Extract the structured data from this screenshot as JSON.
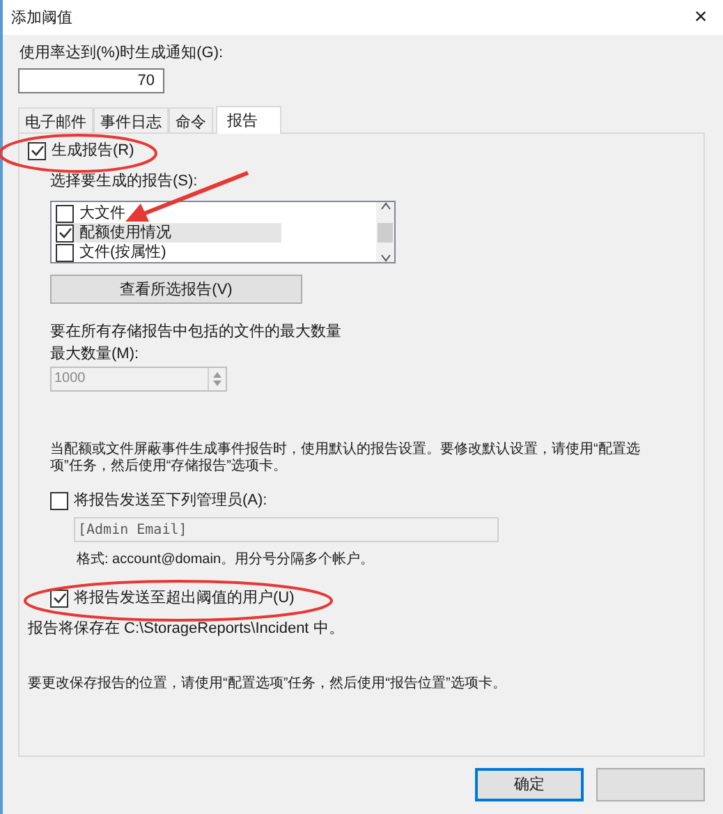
{
  "window": {
    "title": "添加阈值",
    "close": "×"
  },
  "threshold": {
    "label": "使用率达到(%)时生成通知(G):",
    "value": "70"
  },
  "tabs": [
    {
      "label": "电子邮件",
      "selected": false
    },
    {
      "label": "事件日志",
      "selected": false
    },
    {
      "label": "命令",
      "selected": false
    },
    {
      "label": "报告",
      "selected": true
    }
  ],
  "generate_reports": {
    "label": "生成报告(R)",
    "checked": true
  },
  "reports_label": "选择要生成的报告(S):",
  "reports": [
    {
      "label": "大文件",
      "checked": false,
      "selected": false
    },
    {
      "label": "配额使用情况",
      "checked": true,
      "selected": true
    },
    {
      "label": "文件(按属性)",
      "checked": false,
      "selected": false
    }
  ],
  "view_button": "查看所选报告(V)",
  "max_files_text": "要在所有存储报告中包括的文件的最大数量",
  "max_count": {
    "label": "最大数量(M):",
    "value": "1000",
    "disabled": true
  },
  "note": "当配额或文件屏蔽事件生成事件报告时，使用默认的报告设置。要修改默认设置，请使用“配置选项”任务，然后使用“存储报告”选项卡。",
  "send_admins": {
    "label": "将报告发送至下列管理员(A):",
    "checked": false
  },
  "admin_email": {
    "value": "[Admin Email]",
    "disabled": true
  },
  "format_text": "格式: account@domain。用分号分隔多个帐户。",
  "send_users": {
    "label": "将报告发送至超出阈值的用户(U)",
    "checked": true
  },
  "save_location": "报告将保存在 C:\\StorageReports\\Incident 中。",
  "change_location": "要更改保存报告的位置，请使用“配置选项”任务，然后使用“报告位置”选项卡。",
  "buttons": [
    {
      "label": "确定",
      "default": true
    },
    {
      "default": false
    }
  ]
}
